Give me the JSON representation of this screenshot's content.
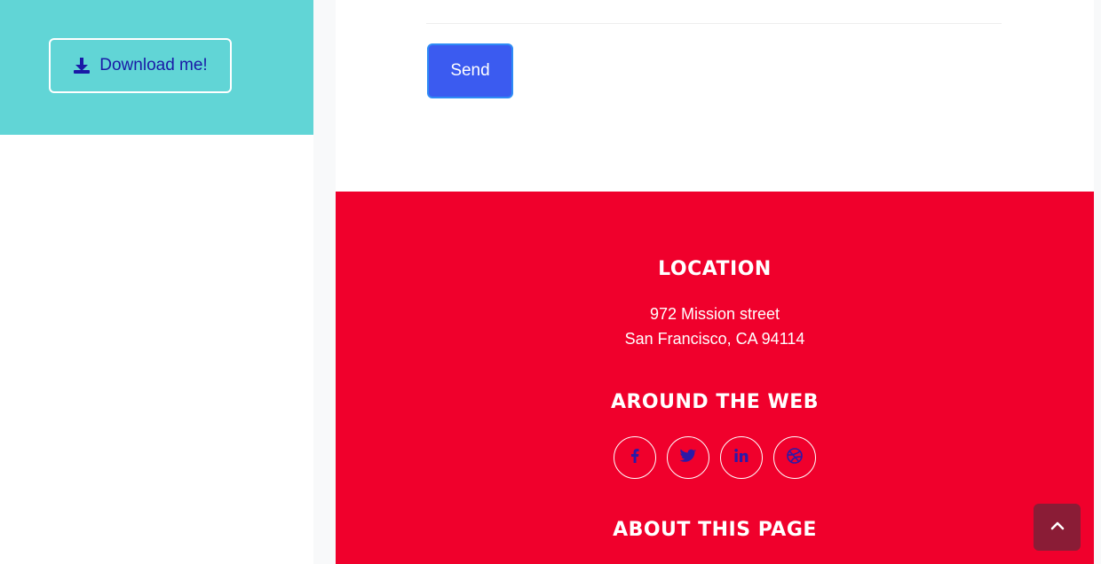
{
  "sidebar": {
    "download_label": "Download me!",
    "download_icon": "download-icon"
  },
  "form": {
    "send_label": "Send"
  },
  "footer": {
    "location_heading": "LOCATION",
    "address_line1": "972 Mission street",
    "address_line2": "San Francisco, CA 94114",
    "web_heading": "AROUND THE WEB",
    "social": [
      {
        "name": "facebook",
        "glyph": "f"
      },
      {
        "name": "twitter",
        "glyph": "twitter-bird"
      },
      {
        "name": "linkedin",
        "glyph": "in"
      },
      {
        "name": "dribbble",
        "glyph": "dribbble-ball"
      }
    ],
    "about_heading": "ABOUT THIS PAGE"
  },
  "scroll_top": {
    "icon": "chevron-up-icon"
  },
  "colors": {
    "sidebar_bg": "#61d5d6",
    "send_button": "#3b5bf0",
    "footer_bg": "#f0002c",
    "scroll_top_bg": "#8a1c36",
    "link_text": "#1a1aa6"
  }
}
